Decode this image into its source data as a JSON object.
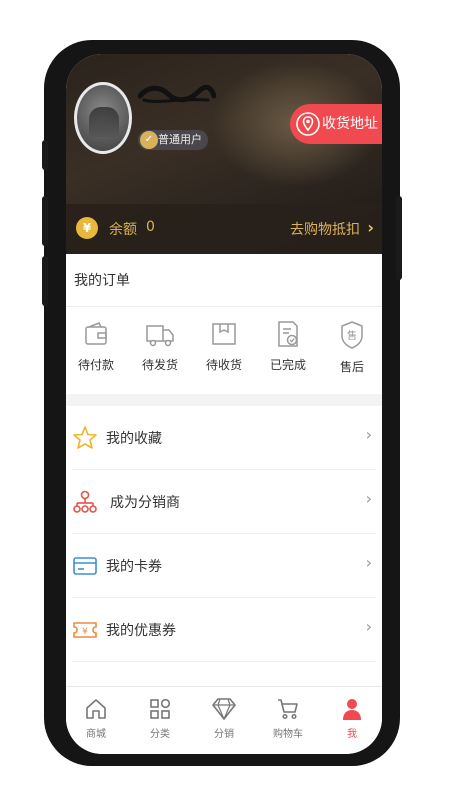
{
  "profile": {
    "member_level": "普通用户",
    "address_button": "收货地址"
  },
  "balance": {
    "currency_icon": "¥",
    "label": "余额",
    "value": "0",
    "action": "去购物抵扣"
  },
  "orders": {
    "title": "我的订单",
    "items": [
      {
        "label": "待付款",
        "icon": "wallet-icon"
      },
      {
        "label": "待发货",
        "icon": "truck-icon"
      },
      {
        "label": "待收货",
        "icon": "package-icon"
      },
      {
        "label": "已完成",
        "icon": "completed-doc-icon"
      },
      {
        "label": "售后",
        "icon": "after-sales-icon"
      }
    ]
  },
  "menu": {
    "items": [
      {
        "label": "我的收藏",
        "icon": "star-icon"
      },
      {
        "label": "成为分销商",
        "icon": "distributor-icon"
      },
      {
        "label": "我的卡券",
        "icon": "card-icon"
      },
      {
        "label": "我的优惠券",
        "icon": "coupon-icon"
      }
    ]
  },
  "tabbar": {
    "items": [
      {
        "label": "商城",
        "icon": "home-icon"
      },
      {
        "label": "分类",
        "icon": "category-icon"
      },
      {
        "label": "分销",
        "icon": "diamond-icon"
      },
      {
        "label": "购物车",
        "icon": "cart-icon"
      },
      {
        "label": "我",
        "icon": "user-icon",
        "active": true
      }
    ]
  },
  "colors": {
    "accent": "#f0494f",
    "gold": "#d9b35b"
  }
}
